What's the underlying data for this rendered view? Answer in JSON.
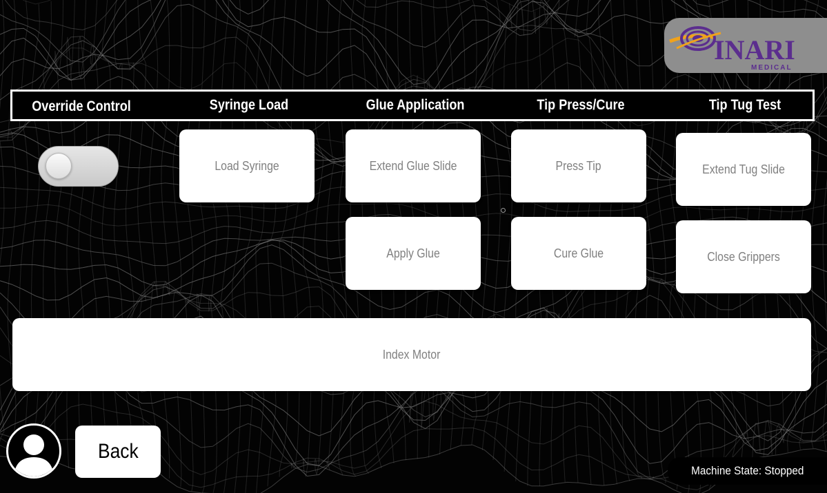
{
  "logo": {
    "brand": "INARI",
    "sub": "MEDICAL"
  },
  "headers": {
    "override": "Override Control",
    "syringe": "Syringe Load",
    "glue": "Glue Application",
    "tip": "Tip Press/Cure",
    "tug": "Tip Tug Test"
  },
  "override": {
    "state": "off"
  },
  "buttons": {
    "load_syringe": "Load Syringe",
    "extend_glue_slide": "Extend Glue Slide",
    "apply_glue": "Apply Glue",
    "press_tip": "Press Tip",
    "cure_glue": "Cure Glue",
    "extend_tug_slide": "Extend Tug Slide",
    "close_grippers": "Close Grippers",
    "index_motor": "Index Motor"
  },
  "footer": {
    "back": "Back",
    "status": "Machine State: Stopped"
  },
  "colors": {
    "accent_purple": "#5b2d8e",
    "accent_orange": "#f0a21c",
    "button_text": "#808080"
  }
}
